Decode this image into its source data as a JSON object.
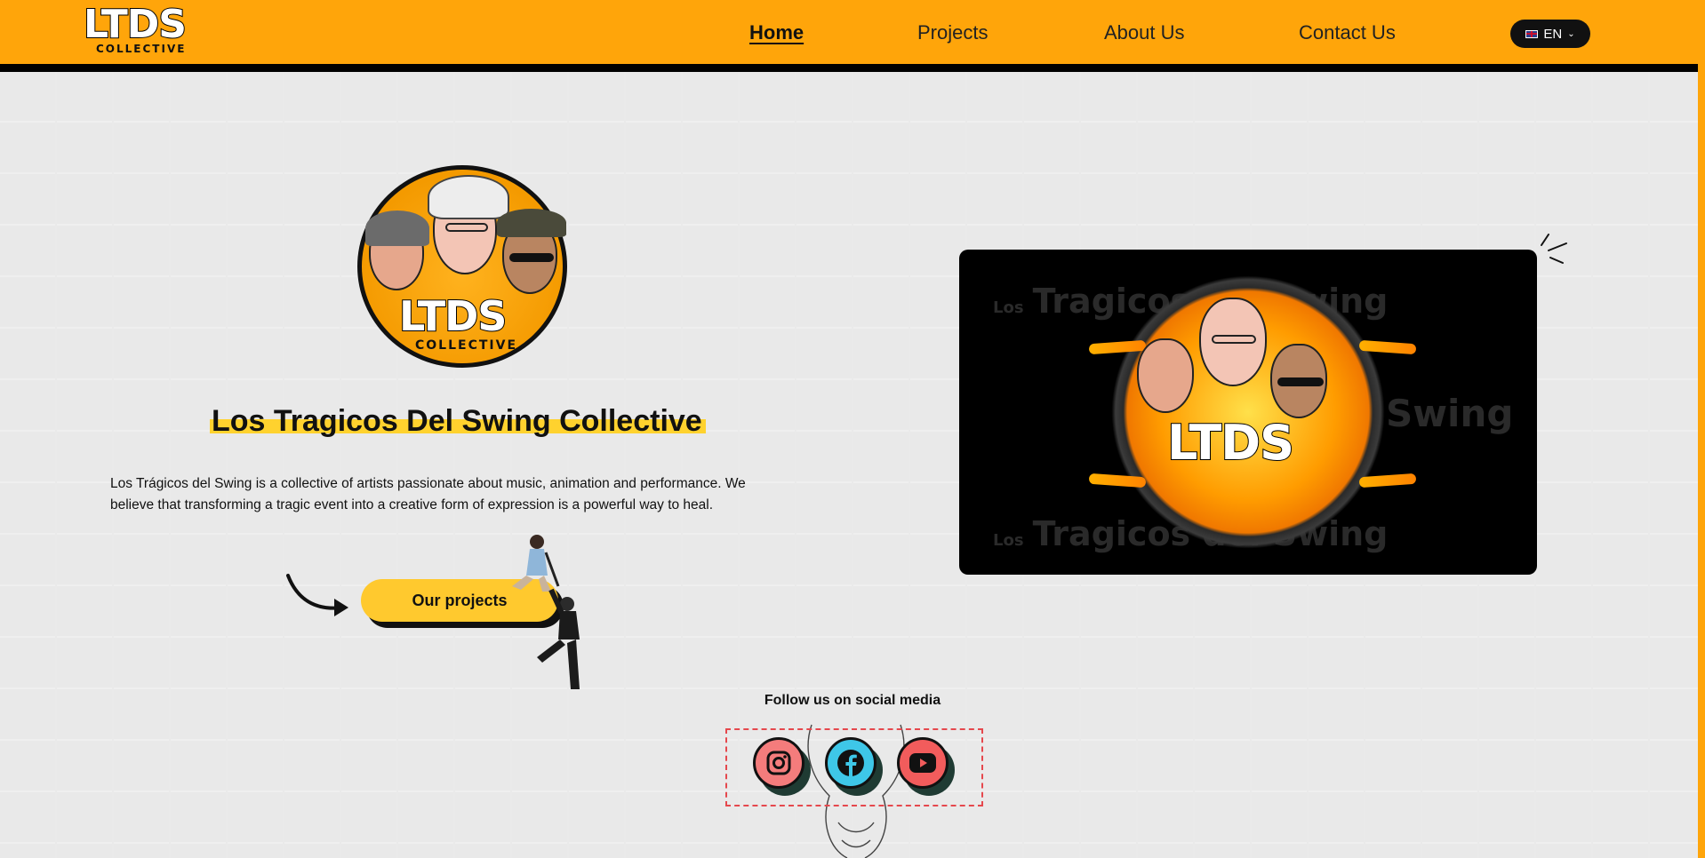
{
  "header": {
    "brand_word": "LTDS",
    "brand_sub": "COLLECTIVE",
    "nav": [
      {
        "label": "Home",
        "active": true
      },
      {
        "label": "Projects",
        "active": false
      },
      {
        "label": "About Us",
        "active": false
      },
      {
        "label": "Contact Us",
        "active": false
      }
    ],
    "language": "EN"
  },
  "hero": {
    "logo_word": "LTDS",
    "logo_sub": "COLLECTIVE",
    "title": "Los Tragicos Del Swing Collective",
    "description": "Los Trágicos del Swing is a collective of artists passionate about music, animation and performance. We believe that transforming a tragic event into a creative form of expression is a powerful way to heal.",
    "cta_label": "Our projects"
  },
  "video": {
    "ghost_small": "Los",
    "ghost_big_1": "Tragicos del Swing",
    "ghost_big_2": "Swing",
    "logo_word": "LTDS"
  },
  "social": {
    "heading": "Follow us on social media",
    "links": [
      {
        "name": "Instagram",
        "icon": "instagram-icon",
        "color": "#F47C7C"
      },
      {
        "name": "Facebook",
        "icon": "facebook-icon",
        "color": "#3EC7E8"
      },
      {
        "name": "YouTube",
        "icon": "youtube-icon",
        "color": "#F25C5C"
      }
    ]
  },
  "colors": {
    "header_bg": "#FFA50A",
    "highlight": "#FFD22E",
    "cta_bg": "#FFC92E"
  }
}
